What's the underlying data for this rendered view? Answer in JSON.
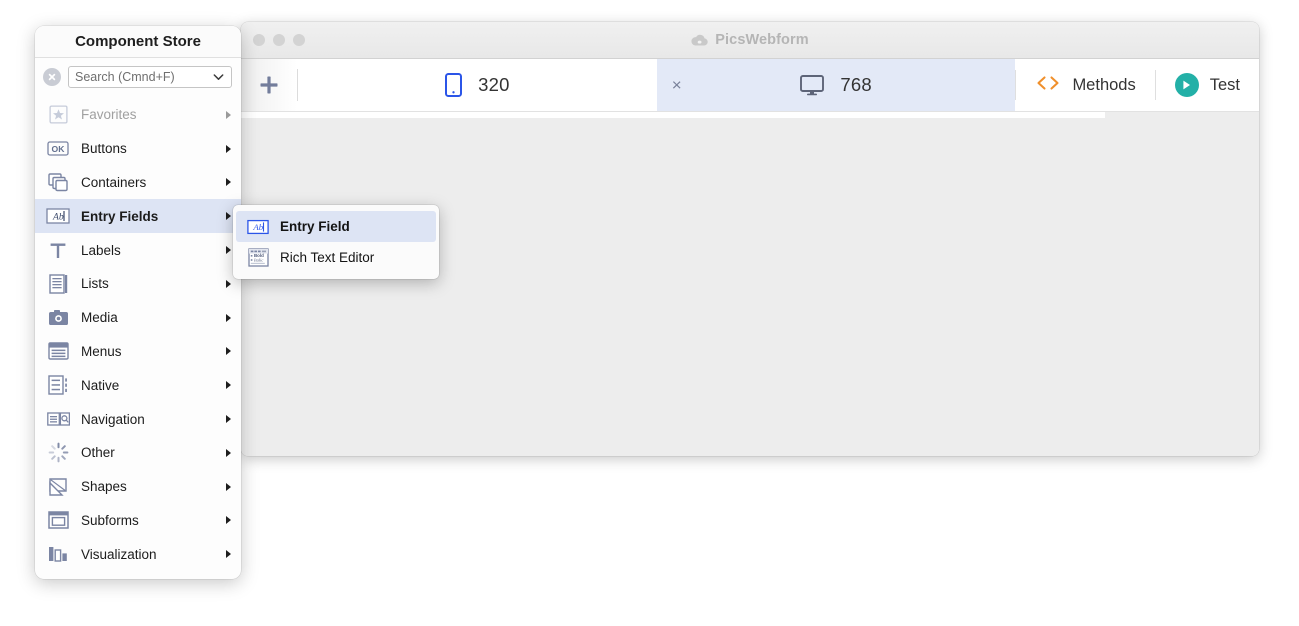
{
  "window": {
    "title": "PicsWebform",
    "title_icon": "cloud-icon",
    "traffic_lights": [
      "close",
      "minimize",
      "zoom"
    ]
  },
  "toolbar": {
    "add_label": "+",
    "tabs": [
      {
        "icon": "phone-icon",
        "label": "320",
        "selected": false,
        "closable": false
      },
      {
        "icon": "monitor-icon",
        "label": "768",
        "selected": true,
        "closable": true,
        "close_label": "×"
      }
    ],
    "buttons": [
      {
        "icon": "code-brackets-icon",
        "label": "Methods",
        "accent": "#f0902c"
      },
      {
        "icon": "play-icon",
        "label": "Test",
        "accent": "#23b0a7"
      }
    ]
  },
  "palette": {
    "header": "Component Store",
    "search": {
      "placeholder": "Search (Cmnd+F)",
      "value": "",
      "clear_icon": "clear-circle-icon",
      "chevron_icon": "chevron-down-icon"
    },
    "items": [
      {
        "label": "Favorites",
        "icon": "star-icon",
        "state": "disabled"
      },
      {
        "label": "Buttons",
        "icon": "ok-button-icon",
        "state": "normal"
      },
      {
        "label": "Containers",
        "icon": "containers-icon",
        "state": "normal"
      },
      {
        "label": "Entry Fields",
        "icon": "entry-field-icon",
        "state": "active"
      },
      {
        "label": "Labels",
        "icon": "text-t-icon",
        "state": "normal"
      },
      {
        "label": "Lists",
        "icon": "list-icon",
        "state": "normal"
      },
      {
        "label": "Media",
        "icon": "camera-icon",
        "state": "normal"
      },
      {
        "label": "Menus",
        "icon": "menu-icon",
        "state": "normal"
      },
      {
        "label": "Native",
        "icon": "native-icon",
        "state": "normal"
      },
      {
        "label": "Navigation",
        "icon": "navigation-icon",
        "state": "normal"
      },
      {
        "label": "Other",
        "icon": "spinner-icon",
        "state": "normal"
      },
      {
        "label": "Shapes",
        "icon": "shapes-icon",
        "state": "normal"
      },
      {
        "label": "Subforms",
        "icon": "subform-icon",
        "state": "normal"
      },
      {
        "label": "Visualization",
        "icon": "chart-bars-icon",
        "state": "normal"
      }
    ]
  },
  "submenu": {
    "items": [
      {
        "label": "Entry Field",
        "icon": "entry-field-icon",
        "highlighted": true
      },
      {
        "label": "Rich Text Editor",
        "icon": "rich-text-editor-icon",
        "highlighted": false
      }
    ]
  },
  "colors": {
    "selection_blue": "#dde4f4",
    "tab_selected": "#e3e9f7",
    "icon_slate": "#7b85a3",
    "methods_orange": "#f0902c",
    "test_teal": "#23b0a7",
    "canvas_gray": "#ededed"
  }
}
